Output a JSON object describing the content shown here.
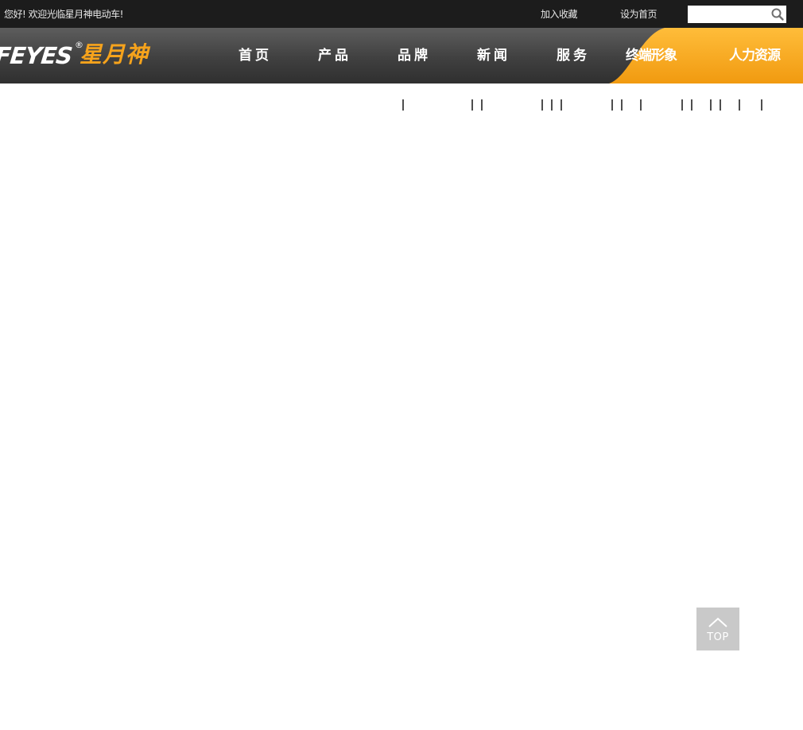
{
  "topbar": {
    "welcome": "您好! 欢迎光临星月神电动车!",
    "add_favorite": "加入收藏",
    "set_homepage": "设为首页",
    "search_placeholder": ""
  },
  "logo": {
    "text_en": "FEYES",
    "registered": "®",
    "text_cn": "星月神"
  },
  "nav": {
    "items": [
      {
        "label": "首页"
      },
      {
        "label": "产品"
      },
      {
        "label": "品牌"
      },
      {
        "label": "新闻"
      },
      {
        "label": "服务"
      },
      {
        "label": "终端形象"
      },
      {
        "label": "人力资源"
      }
    ]
  },
  "back_to_top": {
    "label": "TOP",
    "icon": "chevron-up-icon"
  },
  "colors": {
    "topbar_bg": "#1c1c1c",
    "header_bg": "#404040",
    "accent_orange": "#f6a31c",
    "back_to_top_bg": "#c9c9c9"
  }
}
